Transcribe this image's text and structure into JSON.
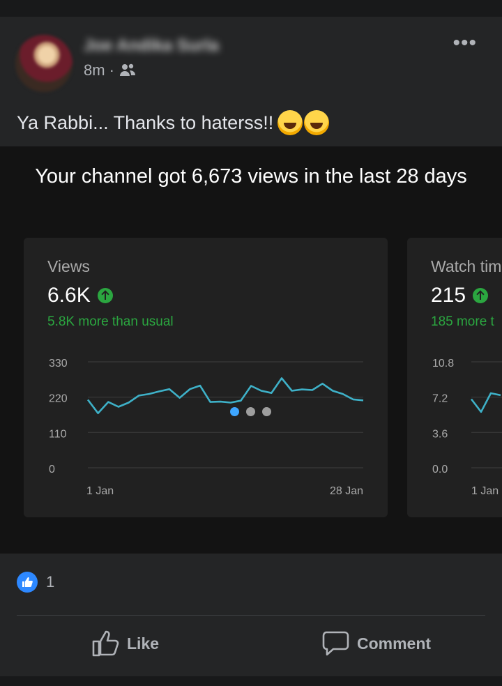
{
  "post": {
    "author": "Joe Andika Surla",
    "time": "8m",
    "audience_icon": "friends-icon",
    "caption": "Ya Rabbi... Thanks to haterss!!",
    "emojis": [
      "rolling-on-floor-laughing",
      "rolling-on-floor-laughing"
    ],
    "more_icon": "more-horizontal-icon"
  },
  "analytics": {
    "headline": "Your channel got 6,673 views in the last 28 days",
    "cards": [
      {
        "title": "Views",
        "value": "6.6K",
        "delta": "5.8K more than usual",
        "trend_icon": "arrow-up-circle-icon"
      },
      {
        "title": "Watch tim",
        "value": "215",
        "delta": "185 more t",
        "trend_icon": "arrow-up-circle-icon"
      }
    ],
    "carousel": {
      "pages": 3,
      "active": 0
    }
  },
  "chart_data": [
    {
      "type": "line",
      "x": [
        1,
        2,
        3,
        4,
        5,
        6,
        7,
        8,
        9,
        10,
        11,
        12,
        13,
        14,
        15,
        16,
        17,
        18,
        19,
        20,
        21,
        22,
        23,
        24,
        25,
        26,
        27,
        28
      ],
      "values": [
        212,
        170,
        205,
        190,
        203,
        225,
        230,
        238,
        245,
        218,
        245,
        256,
        205,
        206,
        203,
        209,
        255,
        240,
        233,
        279,
        240,
        244,
        242,
        262,
        240,
        230,
        213,
        210
      ],
      "yticks": [
        "330",
        "220",
        "110",
        "0"
      ],
      "ylim": [
        0,
        330
      ],
      "xtick_labels": [
        "1 Jan",
        "28 Jan"
      ],
      "line_color": "#3eb1c8",
      "grid": true
    },
    {
      "type": "line",
      "yticks": [
        "10.8",
        "7.2",
        "3.6",
        "0.0"
      ],
      "ylim": [
        0,
        10.8
      ],
      "x": [
        1,
        2,
        3,
        4
      ],
      "values": [
        7.0,
        5.7,
        7.6,
        7.4
      ],
      "xtick_labels": [
        "1 Jan"
      ],
      "line_color": "#3eb1c8",
      "grid": true
    }
  ],
  "footer": {
    "like_count": "1",
    "like_label": "Like",
    "comment_label": "Comment"
  },
  "colors": {
    "card_bg": "#212121",
    "accent_green": "#2ba640",
    "facebook_blue": "#2d88ff"
  }
}
